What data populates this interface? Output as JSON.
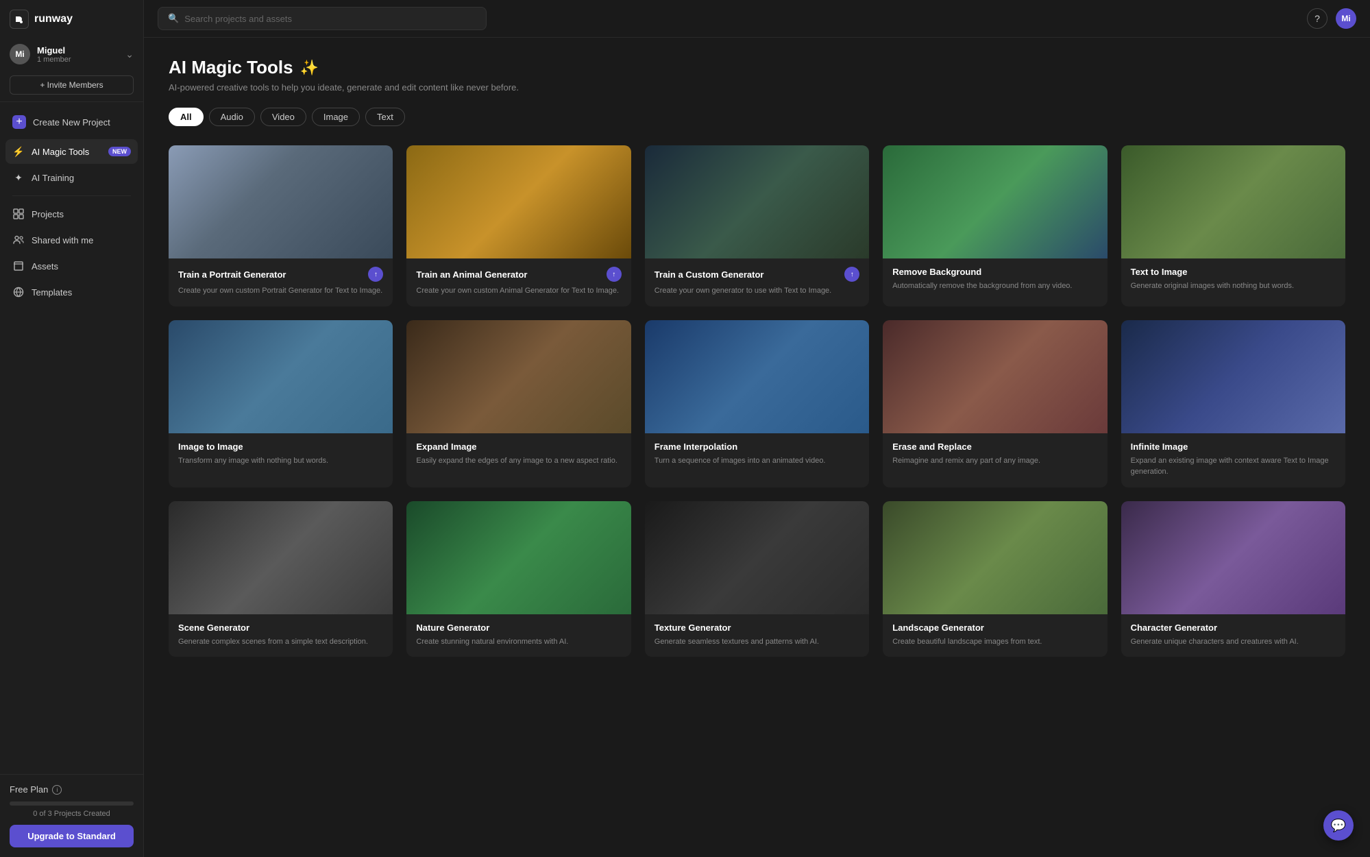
{
  "sidebar": {
    "logo": "R",
    "app_name": "runway",
    "user": {
      "initials": "Mi",
      "name": "Miguel",
      "member_count": "1 member"
    },
    "invite_label": "+ Invite Members",
    "nav": [
      {
        "id": "create-project",
        "label": "Create New Project",
        "icon": "➕",
        "type": "create"
      },
      {
        "id": "ai-magic-tools",
        "label": "AI Magic Tools",
        "icon": "⚡",
        "badge": "New",
        "active": true
      },
      {
        "id": "ai-training",
        "label": "AI Training",
        "icon": "✦"
      },
      {
        "id": "projects",
        "label": "Projects",
        "icon": "⊞"
      },
      {
        "id": "shared-with-me",
        "label": "Shared with me",
        "icon": "👥"
      },
      {
        "id": "assets",
        "label": "Assets",
        "icon": "📁"
      },
      {
        "id": "templates",
        "label": "Templates",
        "icon": "🌐"
      }
    ],
    "footer": {
      "plan": "Free Plan",
      "progress": 0,
      "projects_created": "0 of 3 Projects Created",
      "upgrade_label": "Upgrade to Standard"
    }
  },
  "topbar": {
    "search_placeholder": "Search projects and assets",
    "user_initials": "Mi"
  },
  "page": {
    "title": "AI Magic Tools",
    "wand": "✨",
    "subtitle": "AI-powered creative tools to help you ideate, generate and edit content like never before.",
    "filters": [
      {
        "id": "all",
        "label": "All",
        "active": true
      },
      {
        "id": "audio",
        "label": "Audio"
      },
      {
        "id": "video",
        "label": "Video"
      },
      {
        "id": "image",
        "label": "Image"
      },
      {
        "id": "text",
        "label": "Text"
      }
    ],
    "tools": [
      {
        "id": "portrait-generator",
        "name": "Train a Portrait Generator",
        "desc": "Create your own custom Portrait Generator for Text to Image.",
        "thumb_class": "thumb-portrait",
        "badge": true
      },
      {
        "id": "animal-generator",
        "name": "Train an Animal Generator",
        "desc": "Create your own custom Animal Generator for Text to Image.",
        "thumb_class": "thumb-animal",
        "badge": true
      },
      {
        "id": "custom-generator",
        "name": "Train a Custom Generator",
        "desc": "Create your own generator to use with Text to Image.",
        "thumb_class": "thumb-custom",
        "badge": true
      },
      {
        "id": "remove-background",
        "name": "Remove Background",
        "desc": "Automatically remove the background from any video.",
        "thumb_class": "thumb-remove-bg",
        "badge": false
      },
      {
        "id": "text-to-image",
        "name": "Text to Image",
        "desc": "Generate original images with nothing but words.",
        "thumb_class": "thumb-text-image",
        "badge": false
      },
      {
        "id": "image-to-image",
        "name": "Image to Image",
        "desc": "Transform any image with nothing but words.",
        "thumb_class": "thumb-img2img",
        "badge": false
      },
      {
        "id": "expand-image",
        "name": "Expand Image",
        "desc": "Easily expand the edges of any image to a new aspect ratio.",
        "thumb_class": "thumb-expand",
        "badge": false
      },
      {
        "id": "frame-interpolation",
        "name": "Frame Interpolation",
        "desc": "Turn a sequence of images into an animated video.",
        "thumb_class": "thumb-frame",
        "badge": false
      },
      {
        "id": "erase-and-replace",
        "name": "Erase and Replace",
        "desc": "Reimagine and remix any part of any image.",
        "thumb_class": "thumb-erase",
        "badge": false
      },
      {
        "id": "infinite-image",
        "name": "Infinite Image",
        "desc": "Expand an existing image with context aware Text to Image generation.",
        "thumb_class": "thumb-infinite",
        "badge": false
      },
      {
        "id": "tool-11",
        "name": "Scene Generator",
        "desc": "Generate complex scenes from a simple text description.",
        "thumb_class": "thumb-row3-1",
        "badge": false
      },
      {
        "id": "tool-12",
        "name": "Nature Generator",
        "desc": "Create stunning natural environments with AI.",
        "thumb_class": "thumb-row3-2",
        "badge": false
      },
      {
        "id": "tool-13",
        "name": "Texture Generator",
        "desc": "Generate seamless textures and patterns with AI.",
        "thumb_class": "thumb-row3-3",
        "badge": false
      },
      {
        "id": "tool-14",
        "name": "Landscape Generator",
        "desc": "Create beautiful landscape images from text.",
        "thumb_class": "thumb-row3-4",
        "badge": false
      },
      {
        "id": "tool-15",
        "name": "Character Generator",
        "desc": "Generate unique characters and creatures with AI.",
        "thumb_class": "thumb-row3-5",
        "badge": false
      }
    ]
  }
}
